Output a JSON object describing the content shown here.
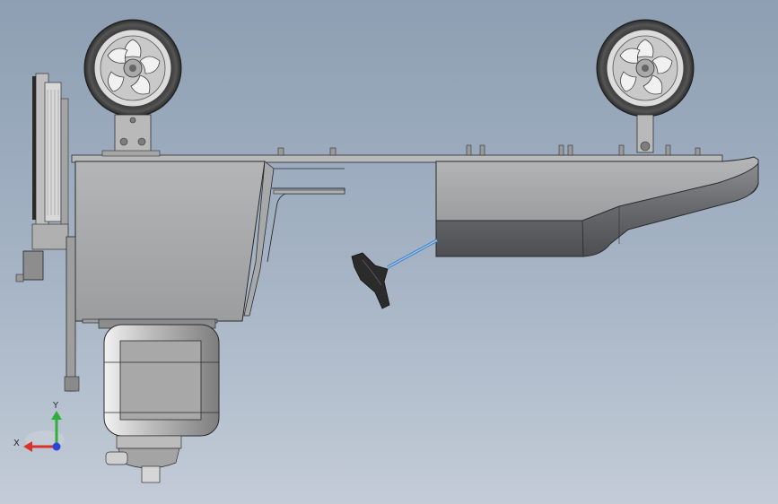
{
  "viewport": {
    "background_top": "#8e9fb3",
    "background_bottom": "#c3ccd7"
  },
  "triad": {
    "x_label": "X",
    "y_label": "Y",
    "x_color": "#d9322a",
    "y_color": "#2fae3c",
    "z_color": "#2a45d8"
  },
  "model": {
    "body_color": "#a9aaac",
    "edge_color": "#2b2b2b",
    "rod_color": "#4a86c7"
  }
}
